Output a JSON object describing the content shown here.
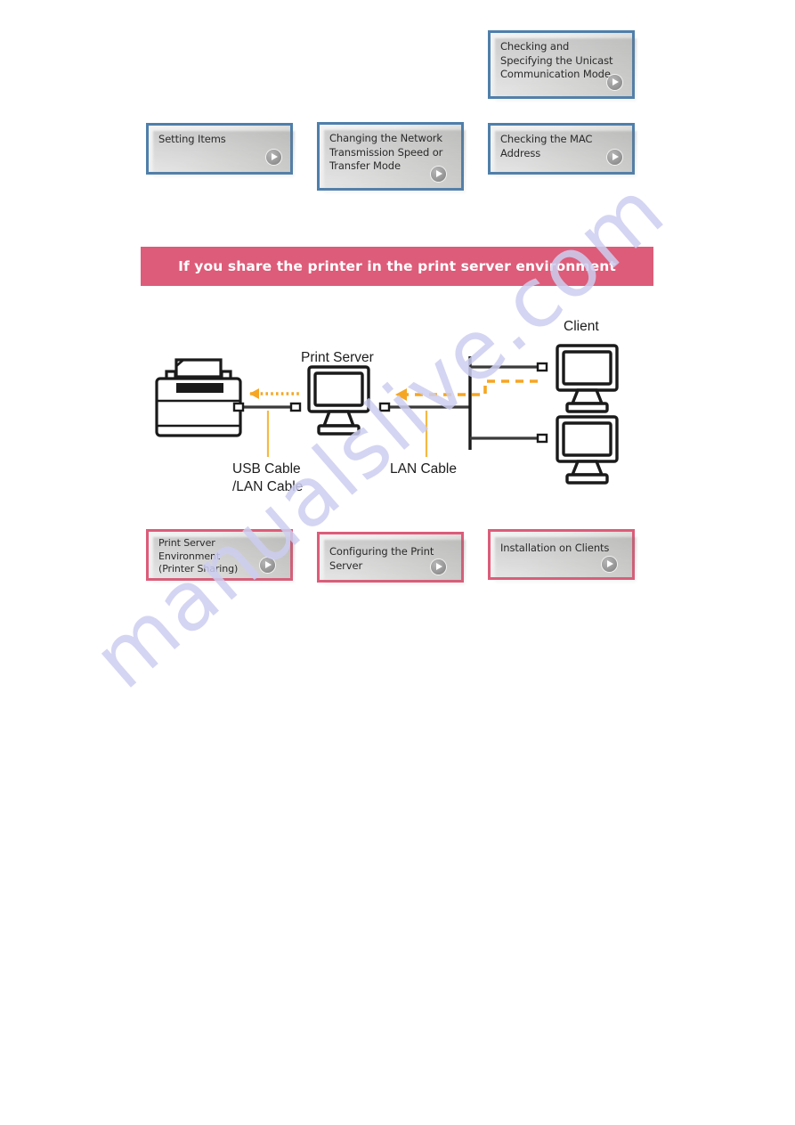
{
  "top_section": {
    "boxes": [
      {
        "id": "setting-items",
        "label": "Setting Items",
        "accent": "#4f7fab"
      },
      {
        "id": "changing-network-speed",
        "label": "Changing the Network\nTransmission Speed or\nTransfer Mode",
        "accent": "#4f7fab"
      },
      {
        "id": "checking-unicast-mode",
        "label": "Checking and\nSpecifying the Unicast\nCommunication Mode",
        "accent": "#4f7fab"
      },
      {
        "id": "checking-mac-address",
        "label": "Checking the MAC\nAddress",
        "accent": "#4f7fab"
      }
    ]
  },
  "banner": {
    "text": "If you share the printer in the print server environment",
    "background": "#dd5c79",
    "color": "#ffffff"
  },
  "diagram": {
    "labels": {
      "print_server": "Print Server",
      "client": "Client",
      "usb_cable": "USB Cable\n/LAN Cable",
      "lan_cable": "LAN Cable"
    },
    "colors": {
      "cable": "#3a3a3a",
      "flow_arrow": "#f5a623",
      "leader_line": "#f5b942",
      "device_outline": "#1a1a1a"
    },
    "nodes": [
      {
        "name": "printer",
        "kind": "printer"
      },
      {
        "name": "print-server",
        "kind": "monitor"
      },
      {
        "name": "client-top",
        "kind": "monitor"
      },
      {
        "name": "client-bottom",
        "kind": "monitor"
      },
      {
        "name": "network-backbone",
        "kind": "vertical-line"
      }
    ],
    "flows": [
      {
        "from": "print-server",
        "to": "printer",
        "style": "dotted",
        "direction": "left"
      },
      {
        "from": "network-backbone",
        "to": "print-server",
        "style": "dashed",
        "direction": "left"
      },
      {
        "from": "client-top",
        "to": "network-backbone",
        "style": "dashed",
        "direction": "left"
      }
    ]
  },
  "bottom_section": {
    "boxes": [
      {
        "id": "print-server-environment",
        "label": "Print Server\nEnvironment\n(Printer Sharing)",
        "accent": "#dd5c79"
      },
      {
        "id": "configuring-print-server",
        "label": "Configuring the Print\nServer",
        "accent": "#dd5c79"
      },
      {
        "id": "installation-on-clients",
        "label": "Installation on Clients",
        "accent": "#dd5c79"
      }
    ]
  },
  "watermark": {
    "text": "manualslive.com",
    "color": "#cdcef0"
  }
}
